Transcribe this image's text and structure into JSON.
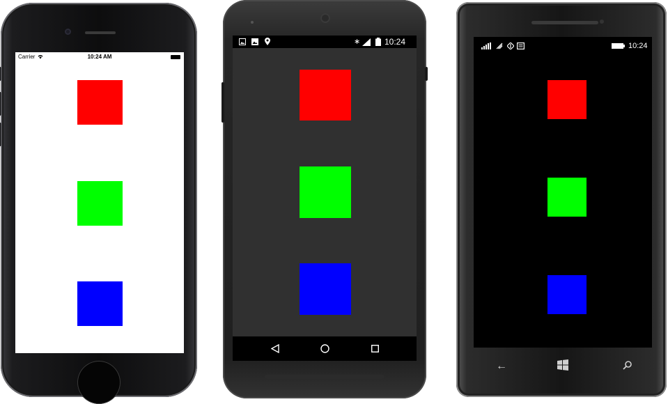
{
  "iphone": {
    "status": {
      "carrier": "Carrier",
      "wifi_icon": "wifi-icon",
      "time": "10:24 AM",
      "battery_icon": "battery-icon"
    },
    "squares": [
      {
        "name": "red-square",
        "color": "#ff0000"
      },
      {
        "name": "green-square",
        "color": "#00ff00"
      },
      {
        "name": "blue-square",
        "color": "#0000ff"
      }
    ]
  },
  "android": {
    "status": {
      "left_icons": [
        "picture-icon",
        "image-icon",
        "location-pin-icon"
      ],
      "right_icons": [
        "bluetooth-icon",
        "signal-icon",
        "battery-icon"
      ],
      "time": "10:24"
    },
    "squares": [
      {
        "name": "red-square",
        "color": "#ff0000"
      },
      {
        "name": "green-square",
        "color": "#00ff00"
      },
      {
        "name": "blue-square",
        "color": "#0000ff"
      }
    ],
    "nav": [
      "back-icon",
      "home-icon",
      "recents-icon"
    ]
  },
  "windows_phone": {
    "status": {
      "left_icons": [
        "signal-icon",
        "wifi-icon",
        "data-icon",
        "message-icon"
      ],
      "battery_icon": "battery-icon",
      "time": "10:24"
    },
    "squares": [
      {
        "name": "red-square",
        "color": "#ff0000"
      },
      {
        "name": "green-square",
        "color": "#00ff00"
      },
      {
        "name": "blue-square",
        "color": "#0000ff"
      }
    ],
    "nav": [
      "back-icon",
      "windows-start-icon",
      "search-icon"
    ]
  }
}
